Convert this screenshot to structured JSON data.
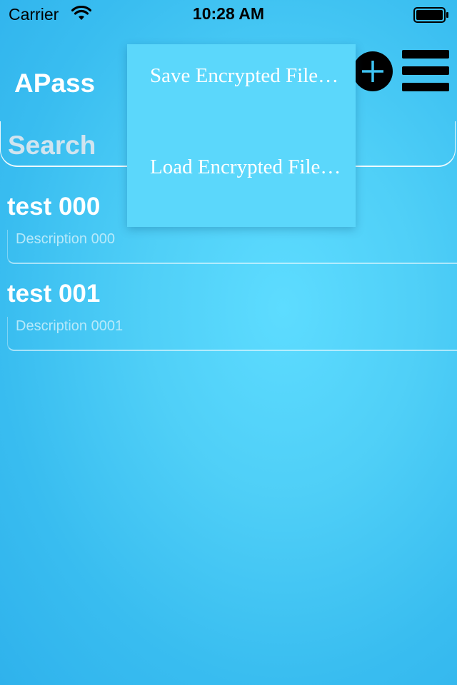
{
  "status_bar": {
    "carrier": "Carrier",
    "time": "10:28 AM"
  },
  "header": {
    "app_title": "APass",
    "add_icon": "plus-circle-icon",
    "menu_icon": "hamburger-menu-icon"
  },
  "search": {
    "placeholder": "Search",
    "value": ""
  },
  "entries": [
    {
      "title": "test 000",
      "description": "Description 000"
    },
    {
      "title": "test 001",
      "description": "Description 0001"
    }
  ],
  "popup_menu": {
    "items": [
      {
        "label": "Save Encrypted File…"
      },
      {
        "label": "Load Encrypted File…"
      }
    ]
  },
  "colors": {
    "background": "#4fcff7",
    "popup_background": "#5bd7fb",
    "text": "#ffffff",
    "icon": "#000000",
    "add_icon_accent": "#3fc4f3"
  }
}
